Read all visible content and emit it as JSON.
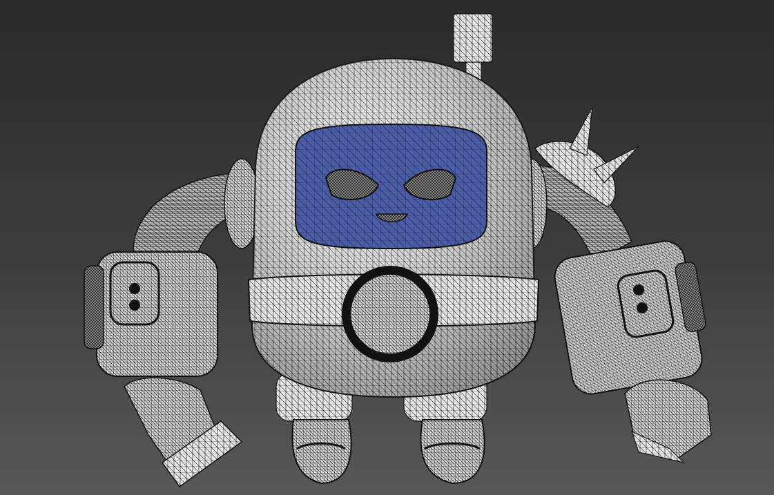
{
  "viewport": {
    "background_top": "#2a2a2a",
    "background_bottom": "#585858"
  },
  "model": {
    "shell_color": "#e6e6e6",
    "wire_color": "#1a1a1a",
    "visor_color": "#4a5da6",
    "shade_color": "#9a9a9a"
  }
}
